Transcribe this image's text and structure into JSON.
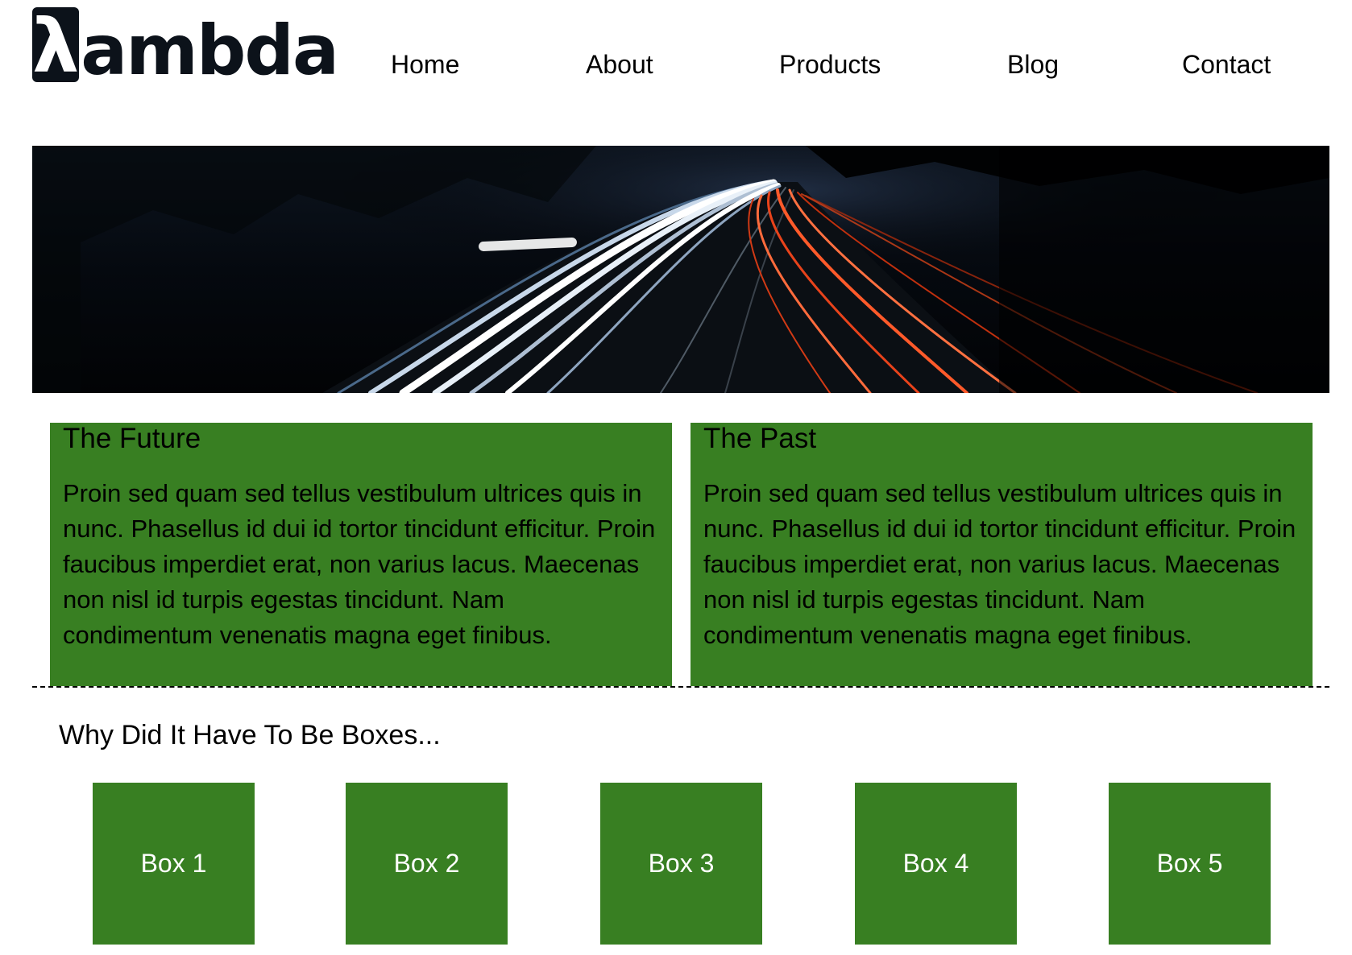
{
  "brand": {
    "logo_glyph": "λ",
    "logo_text": "ambda"
  },
  "nav": {
    "items": [
      "Home",
      "About",
      "Products",
      "Blog",
      "Contact"
    ]
  },
  "hero": {
    "description": ""
  },
  "panels": [
    {
      "title": "The Future",
      "body": "Proin sed quam sed tellus vestibulum ultrices quis in nunc. Phasellus id dui id tortor tincidunt efficitur. Proin faucibus imperdiet erat, non varius lacus. Maecenas non nisl id turpis egestas tincidunt. Nam condimentum venenatis magna eget finibus."
    },
    {
      "title": "The Past",
      "body": "Proin sed quam sed tellus vestibulum ultrices quis in nunc. Phasellus id dui id tortor tincidunt efficitur. Proin faucibus imperdiet erat, non varius lacus. Maecenas non nisl id turpis egestas tincidunt. Nam condimentum venenatis magna eget finibus."
    }
  ],
  "boxes_section": {
    "title": "Why Did It Have To Be Boxes...",
    "boxes": [
      "Box 1",
      "Box 2",
      "Box 3",
      "Box 4",
      "Box 5"
    ]
  },
  "colors": {
    "accent_green": "#387f22",
    "logo_dark": "#0c121a",
    "text": "#000000",
    "box_text": "#ffffff"
  }
}
